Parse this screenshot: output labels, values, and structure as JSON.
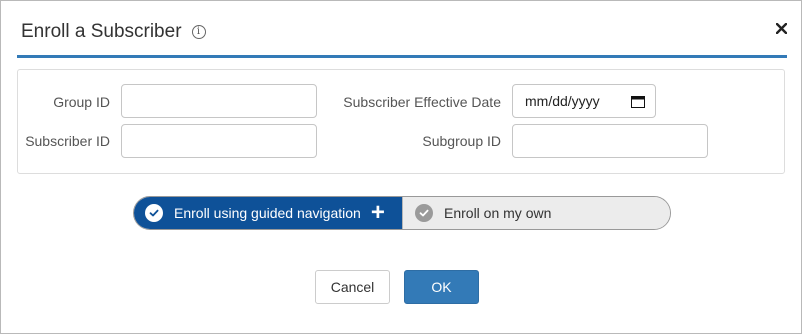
{
  "dialog": {
    "title": "Enroll a Subscriber",
    "info_icon": "i",
    "close_label": "×"
  },
  "form": {
    "group_id_label": "Group ID",
    "group_id_value": "",
    "subscriber_id_label": "Subscriber ID",
    "subscriber_id_value": "",
    "effective_date_label": "Subscriber Effective Date",
    "effective_date_placeholder": "mm/dd/yyyy",
    "subgroup_id_label": "Subgroup ID",
    "subgroup_id_value": ""
  },
  "mode_toggle": {
    "guided_label": "Enroll using guided navigation",
    "guided_suffix": "+",
    "own_label": "Enroll on my own",
    "selected": "guided"
  },
  "buttons": {
    "cancel_label": "Cancel",
    "ok_label": "OK"
  },
  "colors": {
    "accent": "#337ab7",
    "toggle_active": "#0e5198",
    "toggle_inactive": "#ececec"
  },
  "icons": {
    "info": "info-icon",
    "close": "close-icon",
    "calendar": "calendar-icon",
    "check": "check-circle-icon",
    "plus": "plus-icon"
  }
}
